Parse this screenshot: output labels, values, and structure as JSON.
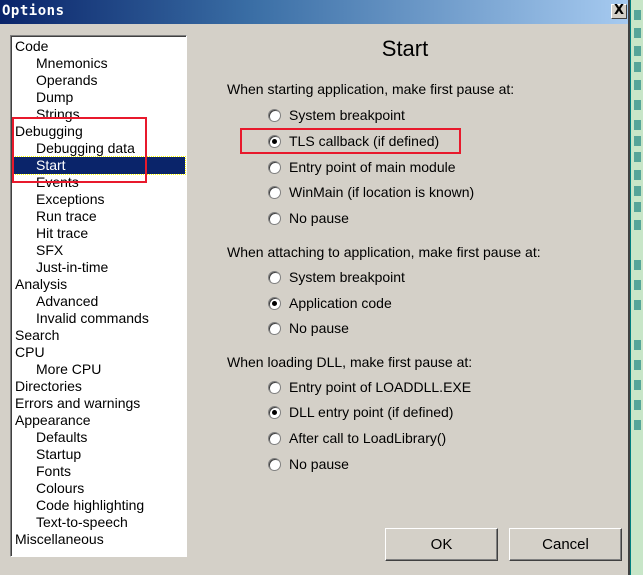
{
  "window": {
    "title": "Options",
    "close_label": "X"
  },
  "tree": {
    "items": [
      {
        "label": "Code",
        "level": 0
      },
      {
        "label": "Mnemonics",
        "level": 1
      },
      {
        "label": "Operands",
        "level": 1
      },
      {
        "label": "Dump",
        "level": 1
      },
      {
        "label": "Strings",
        "level": 1
      },
      {
        "label": "Debugging",
        "level": 0
      },
      {
        "label": "Debugging data",
        "level": 1
      },
      {
        "label": "Start",
        "level": 1,
        "selected": true
      },
      {
        "label": "Events",
        "level": 1
      },
      {
        "label": "Exceptions",
        "level": 1
      },
      {
        "label": "Run trace",
        "level": 1
      },
      {
        "label": "Hit trace",
        "level": 1
      },
      {
        "label": "SFX",
        "level": 1
      },
      {
        "label": "Just-in-time",
        "level": 1
      },
      {
        "label": "Analysis",
        "level": 0
      },
      {
        "label": "Advanced",
        "level": 1
      },
      {
        "label": "Invalid commands",
        "level": 1
      },
      {
        "label": "Search",
        "level": 0
      },
      {
        "label": "CPU",
        "level": 0
      },
      {
        "label": "More CPU",
        "level": 1
      },
      {
        "label": "Directories",
        "level": 0
      },
      {
        "label": "Errors and warnings",
        "level": 0
      },
      {
        "label": "Appearance",
        "level": 0
      },
      {
        "label": "Defaults",
        "level": 1
      },
      {
        "label": "Startup",
        "level": 1
      },
      {
        "label": "Fonts",
        "level": 1
      },
      {
        "label": "Colours",
        "level": 1
      },
      {
        "label": "Code highlighting",
        "level": 1
      },
      {
        "label": "Text-to-speech",
        "level": 1
      },
      {
        "label": "Miscellaneous",
        "level": 0
      }
    ]
  },
  "main": {
    "heading": "Start",
    "groups": [
      {
        "label": "When starting application, make first pause at:",
        "options": [
          {
            "label": "System breakpoint",
            "checked": false
          },
          {
            "label": "TLS callback (if defined)",
            "checked": true
          },
          {
            "label": "Entry point of main module",
            "checked": false
          },
          {
            "label": "WinMain (if location is known)",
            "checked": false
          },
          {
            "label": "No pause",
            "checked": false
          }
        ]
      },
      {
        "label": "When attaching to application, make first pause at:",
        "options": [
          {
            "label": "System breakpoint",
            "checked": false
          },
          {
            "label": "Application code",
            "checked": true
          },
          {
            "label": "No pause",
            "checked": false
          }
        ]
      },
      {
        "label": "When loading DLL, make first pause at:",
        "options": [
          {
            "label": "Entry point of LOADDLL.EXE",
            "checked": false
          },
          {
            "label": "DLL entry point (if defined)",
            "checked": true
          },
          {
            "label": "After call to LoadLibrary()",
            "checked": false
          },
          {
            "label": "No pause",
            "checked": false
          }
        ]
      }
    ],
    "ok_label": "OK",
    "cancel_label": "Cancel"
  },
  "colors": {
    "selection": "#0a246a",
    "annotation": "#e8192c",
    "face": "#d4d0c8"
  }
}
